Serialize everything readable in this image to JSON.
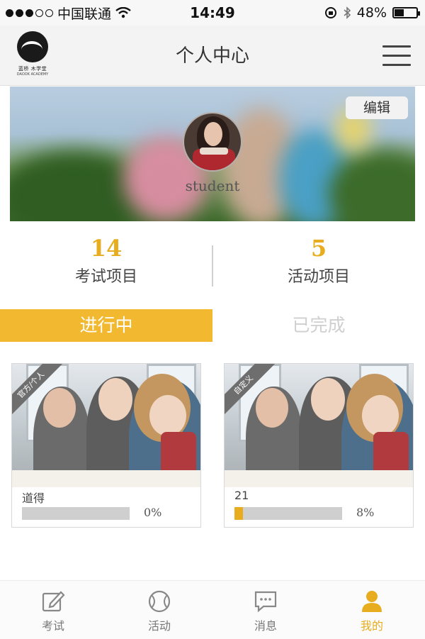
{
  "status_bar": {
    "carrier": "中国联通",
    "time": "14:49",
    "battery_text": "48%",
    "battery_level": 0.48
  },
  "header": {
    "logo_text": "蓝桥 木学堂",
    "logo_subtext": "DAOOK ACADEMY",
    "title": "个人中心",
    "menu_icon": "hamburger-icon"
  },
  "profile": {
    "edit_label": "编辑",
    "username": "student"
  },
  "stats": [
    {
      "value": "14",
      "label": "考试项目"
    },
    {
      "value": "5",
      "label": "活动项目"
    }
  ],
  "tabs": [
    {
      "label": "进行中",
      "active": true
    },
    {
      "label": "已完成",
      "active": false
    }
  ],
  "cards": [
    {
      "badge": "官方/个人",
      "title": "道得",
      "progress": 0,
      "progress_text": "0%"
    },
    {
      "badge": "自定义",
      "title": "21",
      "progress": 0.08,
      "progress_text": "8%"
    }
  ],
  "bottom_nav": [
    {
      "label": "考试",
      "icon": "edit-icon",
      "active": false
    },
    {
      "label": "活动",
      "icon": "ball-icon",
      "active": false
    },
    {
      "label": "消息",
      "icon": "message-icon",
      "active": false
    },
    {
      "label": "我的",
      "icon": "user-icon",
      "active": true
    }
  ],
  "colors": {
    "accent": "#f2b930",
    "stat_number": "#e7ad1f",
    "inactive_tab_text": "#cfcfcf"
  }
}
